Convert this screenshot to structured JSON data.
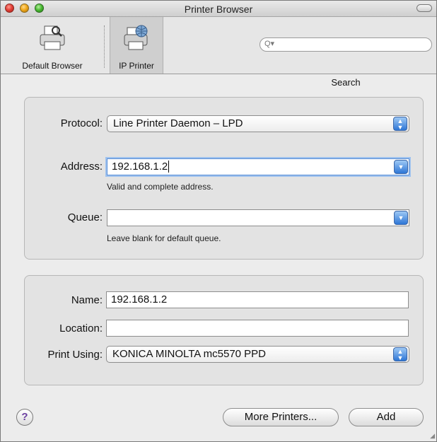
{
  "window": {
    "title": "Printer Browser"
  },
  "toolbar": {
    "default_browser_label": "Default Browser",
    "ip_printer_label": "IP Printer",
    "search_label": "Search",
    "search_placeholder": ""
  },
  "connection": {
    "protocol_label": "Protocol:",
    "protocol_value": "Line Printer Daemon – LPD",
    "address_label": "Address:",
    "address_value": "192.168.1.2",
    "address_hint": "Valid and complete address.",
    "queue_label": "Queue:",
    "queue_value": "",
    "queue_hint": "Leave blank for default queue."
  },
  "details": {
    "name_label": "Name:",
    "name_value": "192.168.1.2",
    "location_label": "Location:",
    "location_value": "",
    "print_using_label": "Print Using:",
    "print_using_value": "KONICA MINOLTA mc5570 PPD"
  },
  "footer": {
    "help_glyph": "?",
    "more_printers_label": "More Printers...",
    "add_label": "Add"
  },
  "colors": {
    "accent": "#2d76d6"
  }
}
